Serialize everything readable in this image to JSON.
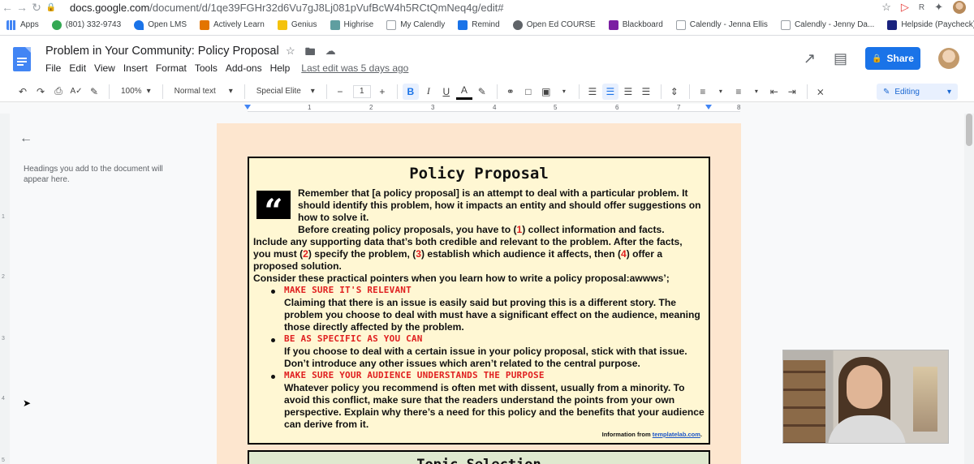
{
  "browser": {
    "url_host": "docs.google.com",
    "url_path": "/document/d/1qe39FGHr32d6Vu7gJ8Lj081pVufBcW4h5RCtQmNeq4g/edit#"
  },
  "bookmarks": [
    {
      "label": "Apps",
      "icon": "apps-icon",
      "color": "#5f6368"
    },
    {
      "label": "(801) 332-9743",
      "icon": "phone-icon",
      "color": "#34a853"
    },
    {
      "label": "Open LMS",
      "icon": "lms-icon",
      "color": "#1a73e8"
    },
    {
      "label": "Actively Learn",
      "icon": "al-icon",
      "color": "#e37400"
    },
    {
      "label": "Genius",
      "icon": "genius-icon",
      "color": "#f4c20d"
    },
    {
      "label": "Highrise",
      "icon": "highrise-icon",
      "color": "#5f9ea0"
    },
    {
      "label": "My Calendly",
      "icon": "calendly-icon",
      "color": "#9aa0a6"
    },
    {
      "label": "Remind",
      "icon": "remind-icon",
      "color": "#1a73e8"
    },
    {
      "label": "Open Ed COURSE",
      "icon": "globe-icon",
      "color": "#5f6368"
    },
    {
      "label": "Blackboard",
      "icon": "blackboard-icon",
      "color": "#7b1fa2"
    },
    {
      "label": "Calendly - Jenna Ellis",
      "icon": "calendly-icon",
      "color": "#9aa0a6"
    },
    {
      "label": "Calendly - Jenny Da...",
      "icon": "calendly-icon",
      "color": "#9aa0a6"
    },
    {
      "label": "Helpside (Paycheck)",
      "icon": "helpside-icon",
      "color": "#1a237e"
    }
  ],
  "doc": {
    "title": "Problem in Your Community: Policy Proposal",
    "last_edit": "Last edit was 5 days ago",
    "menu": [
      "File",
      "Edit",
      "View",
      "Insert",
      "Format",
      "Tools",
      "Add-ons",
      "Help"
    ],
    "share_label": "Share"
  },
  "toolbar": {
    "zoom": "100%",
    "style": "Normal text",
    "font": "Special Elite",
    "font_size": "1",
    "editing_label": "Editing"
  },
  "ruler": {
    "numbers": [
      "1",
      "1",
      "2",
      "3",
      "4",
      "5",
      "6",
      "7",
      "8"
    ]
  },
  "outline": {
    "hint": "Headings you add to the document will appear here."
  },
  "content": {
    "title": "Policy Proposal",
    "intro": "Remember that [a policy proposal] is an attempt to deal with a particular problem. It should identify this problem, how it impacts an entity and should offer suggestions on how to solve it.",
    "before_a": "Before creating policy proposals, you have to (",
    "n1": "1",
    "before_b": ") collect information and facts.",
    "line2": "Include any supporting data that’s both credible and relevant to the problem. After the facts,",
    "line3_a": "you must (",
    "n2": "2",
    "line3_b": ") specify the problem, (",
    "n3": "3",
    "line3_c": ") establish which audience it affects, then (",
    "n4": "4",
    "line3_d": ") offer a",
    "line4": "proposed solution.",
    "consider": "Consider these practical pointers when you learn how to write a policy proposal:awwws’;",
    "bullets": [
      {
        "head": "MAKE SURE IT'S RELEVANT",
        "body": "Claiming that there is an issue is easily said but proving this is a different story. The problem you choose to deal with must have a significant effect on the audience, meaning those directly affected by the problem."
      },
      {
        "head": "BE AS SPECIFIC AS YOU CAN",
        "body": "If you choose to deal with a certain issue in your policy proposal, stick with that issue. Don’t introduce any other issues which aren’t related to the central purpose."
      },
      {
        "head": "MAKE SURE YOUR AUDIENCE UNDERSTANDS THE PURPOSE",
        "body": "Whatever policy you recommend is often met with dissent, usually from a minority. To avoid this conflict, make sure that the readers understand the points from your own perspective. Explain why there’s a need for this policy and the benefits that your audience can derive from it."
      }
    ],
    "info_prefix": "Information from ",
    "info_link": "templatelab.com",
    "info_suffix": ".",
    "next_box_title": "Topic Selection"
  },
  "colors": {
    "accent": "#1a73e8",
    "page_bg": "#fde6cf",
    "box_bg": "#fff7d3",
    "highlight_red": "#e02020"
  }
}
